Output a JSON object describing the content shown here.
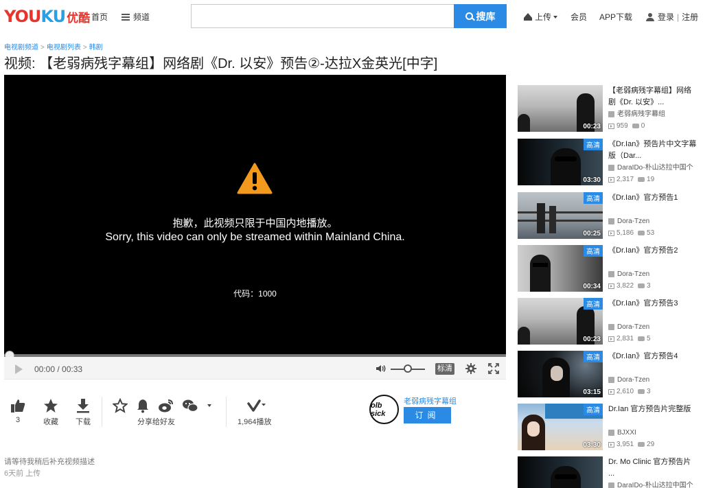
{
  "header": {
    "logo_text": "YOUKU",
    "logo_cn": "优酷",
    "home": "首页",
    "channel": "频道",
    "search_placeholder": "",
    "search_button": "搜库",
    "upload": "上传",
    "vip": "会员",
    "app": "APP下载",
    "login": "登录",
    "separator": "|",
    "register": "注册"
  },
  "breadcrumb": [
    "电视剧频道",
    "电视剧列表",
    "韩剧"
  ],
  "breadcrumb_sep": ">",
  "title": "视频: 【老弱病残字幕组】网络剧《Dr. 以安》预告②-达拉X金英光[中字]",
  "player": {
    "warning_icon": "warning-icon",
    "message_cn": "抱歉，此视频只限于中国内地播放。",
    "message_en": "Sorry, this video can only be streamed within Mainland China.",
    "code": "代码：1000",
    "time": "00:00 / 00:33",
    "progress": 0,
    "volume": 0.5,
    "quality": "标清",
    "accent_color": "#2a8ae4"
  },
  "actions": {
    "like_count": "3",
    "favorite": "收藏",
    "download": "下载",
    "share": "分享给好友",
    "plays": "1,964播放",
    "channel_name": "老弱病残字幕组",
    "channel_logo": "olb sick",
    "subscribe": "订阅"
  },
  "description": "请等待我稍后补充视频描述",
  "upload_time": "6天前 上传",
  "related": [
    {
      "title": "【老弱病残字幕组】网络剧《Dr. 以安》...",
      "user": "老弱病残字幕组",
      "plays": "959",
      "comments": "0",
      "duration": "00:23",
      "hd": ""
    },
    {
      "title": "《Dr.Ian》预告片中文字幕版（Dar...",
      "user": "DaraIDo-朴山达拉中国个",
      "plays": "2,317",
      "comments": "19",
      "duration": "03:30",
      "hd": "高清"
    },
    {
      "title": "《Dr.Ian》官方预告1",
      "user": "Dora-Tzen",
      "plays": "5,186",
      "comments": "53",
      "duration": "00:25",
      "hd": "高清"
    },
    {
      "title": "《Dr.Ian》官方预告2",
      "user": "Dora-Tzen",
      "plays": "3,822",
      "comments": "3",
      "duration": "00:34",
      "hd": "高清"
    },
    {
      "title": "《Dr.Ian》官方预告3",
      "user": "Dora-Tzen",
      "plays": "2,831",
      "comments": "5",
      "duration": "00:23",
      "hd": "高清"
    },
    {
      "title": "《Dr.Ian》官方预告4",
      "user": "Dora-Tzen",
      "plays": "2,610",
      "comments": "3",
      "duration": "03:15",
      "hd": "高清"
    },
    {
      "title": "Dr.Ian 官方预告片完整版",
      "user": "BJXXI",
      "plays": "3,951",
      "comments": "29",
      "duration": "03:30",
      "hd": "高清"
    },
    {
      "title": "Dr. Mo Clinic 官方预告片 ...",
      "user": "DaraIDo-朴山达拉中国个",
      "plays": "",
      "comments": "",
      "duration": "",
      "hd": ""
    }
  ]
}
